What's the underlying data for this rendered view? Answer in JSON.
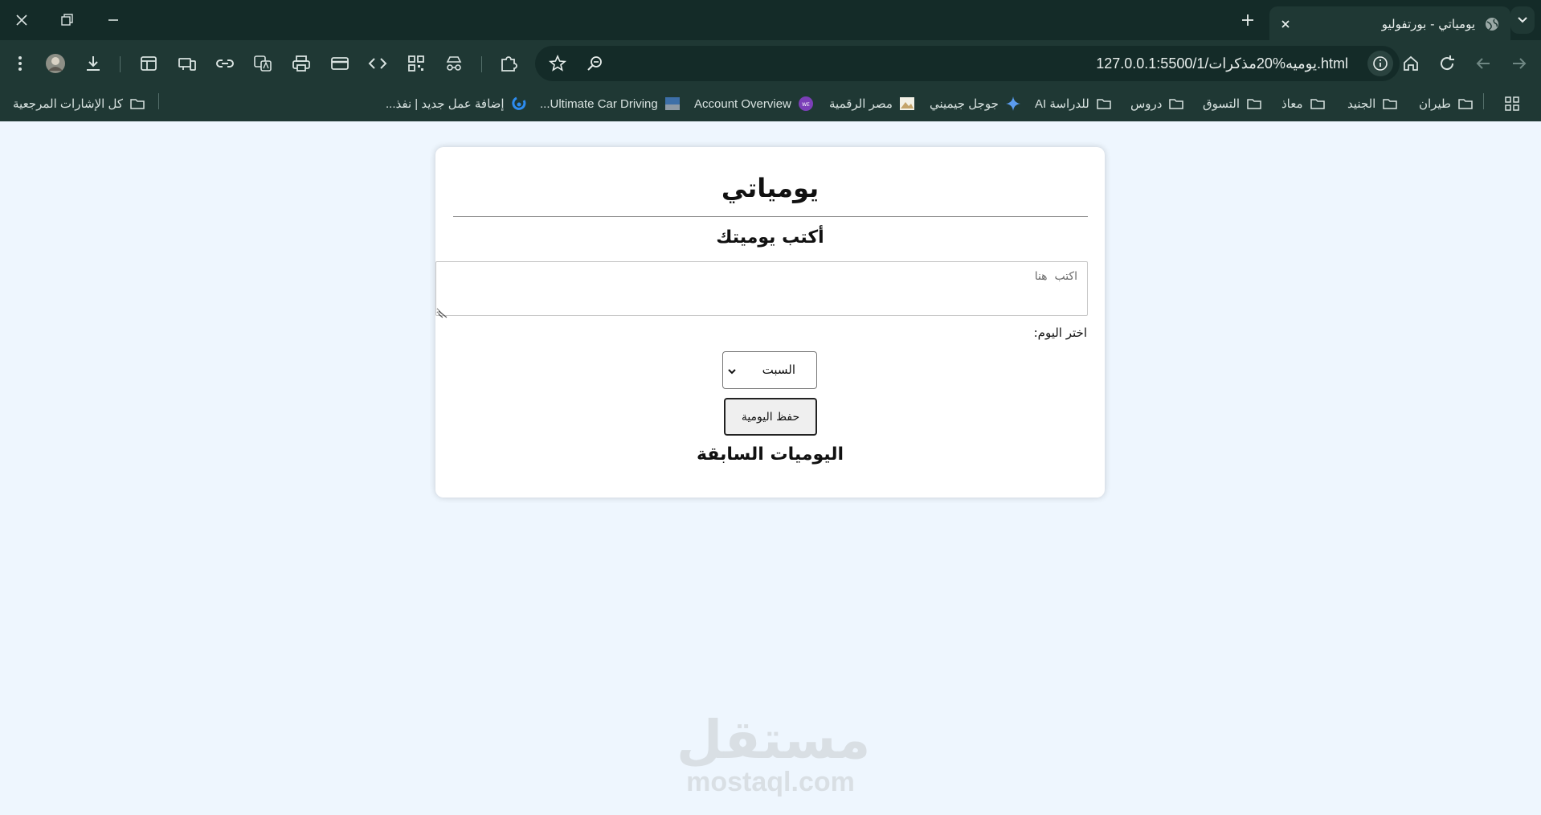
{
  "browser": {
    "tab_title": "يومياتي - بورتفوليو",
    "url": "127.0.0.1:5500/1/يوميه%20مذكرات.html",
    "bookmarks": [
      {
        "label": "طيران",
        "icon": "folder-icon"
      },
      {
        "label": "الجنيد",
        "icon": "folder-icon"
      },
      {
        "label": "معاذ",
        "icon": "folder-icon"
      },
      {
        "label": "التسوق",
        "icon": "folder-icon"
      },
      {
        "label": "دروس",
        "icon": "folder-icon"
      },
      {
        "label": "للدراسة AI",
        "icon": "folder-icon"
      },
      {
        "label": "جوجل جيميني",
        "icon": "sparkle-icon"
      },
      {
        "label": "مصر الرقمية",
        "icon": "image-icon"
      },
      {
        "label": "Account Overview",
        "icon": "web-icon"
      },
      {
        "label": "Ultimate Car Driving...",
        "icon": "game-icon"
      },
      {
        "label": "إضافة عمل جديد | نفذ...",
        "icon": "blue-logo-icon"
      }
    ],
    "all_bookmarks_label": "كل الإشارات المرجعية"
  },
  "page": {
    "title": "يومياتي",
    "subtitle": "أكتب يوميتك",
    "entry_placeholder": "اكتب  هنا",
    "day_label": "اختر اليوم:",
    "day_selected": "السبت",
    "save_button": "حفظ اليومية",
    "previous_title": "اليوميات السابقة"
  },
  "watermark": {
    "arabic": "مستقل",
    "latin": "mostaql.com"
  },
  "colors": {
    "chrome_dark": "#142b28",
    "chrome": "#1f3834",
    "page_background": "#eef6fe",
    "card": "#ffffff"
  }
}
